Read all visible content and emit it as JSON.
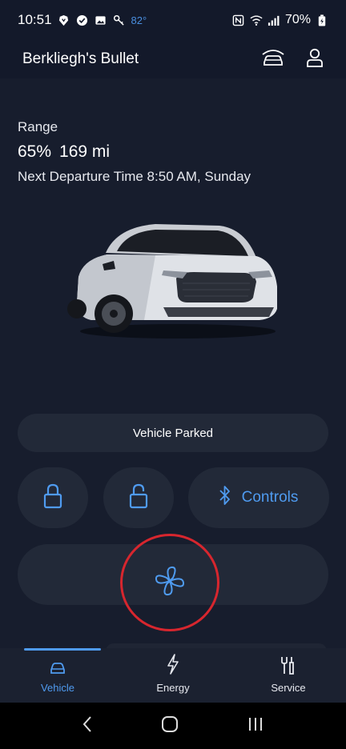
{
  "status_bar": {
    "time": "10:51",
    "temperature": "82°",
    "battery": "70%"
  },
  "header": {
    "title": "Berkliegh's Bullet"
  },
  "vehicle": {
    "range_label": "Range",
    "range_percent": "65%",
    "range_miles": "169 mi",
    "departure": "Next Departure Time 8:50 AM, Sunday",
    "status": "Vehicle Parked"
  },
  "controls": {
    "controls_label": "Controls"
  },
  "bottom_nav": {
    "items": [
      {
        "label": "Vehicle",
        "active": true
      },
      {
        "label": "Energy",
        "active": false
      },
      {
        "label": "Service",
        "active": false
      }
    ]
  },
  "colors": {
    "accent": "#4f9bf0",
    "highlight_circle": "#d7262e",
    "background": "#171d2d"
  }
}
